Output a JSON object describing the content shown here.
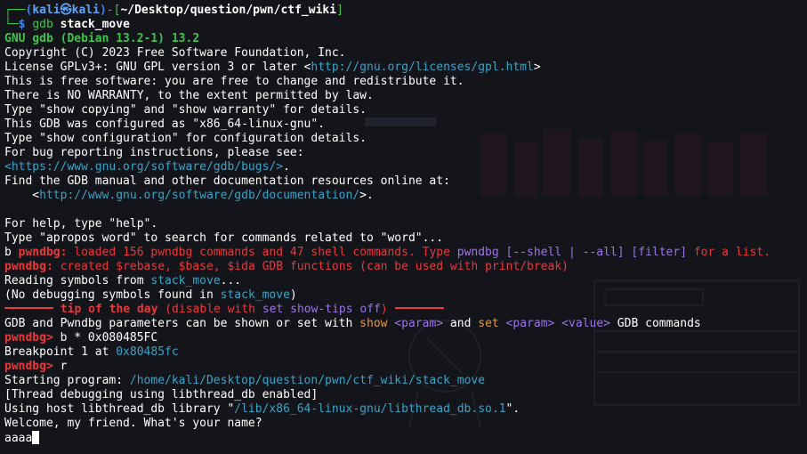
{
  "prompt": {
    "corner_top": "┌──",
    "user_host_open": "(",
    "user": "kali",
    "at_symbol": "㉿",
    "host": "kali",
    "user_host_close": ")",
    "dash_bracket_open": "-[",
    "cwd": "~/Desktop/question/pwn/ctf_wiki",
    "bracket_close": "]",
    "corner_bottom": "└─",
    "dollar": "$",
    "command_name": "gdb",
    "command_arg": "stack_move"
  },
  "gdb": {
    "banner": "GNU gdb (Debian 13.2-1) 13.2",
    "copyright": "Copyright (C) 2023 Free Software Foundation, Inc.",
    "license_prefix": "License GPLv3+: GNU GPL version 3 or later <",
    "license_url": "http://gnu.org/licenses/gpl.html",
    "license_suffix": ">",
    "free_software": "This is free software: you are free to change and redistribute it.",
    "no_warranty": "There is NO WARRANTY, to the extent permitted by law.",
    "show_copying": "Type \"show copying\" and \"show warranty\" for details.",
    "configured_as": "This GDB was configured as \"x86_64-linux-gnu\".",
    "show_configuration": "Type \"show configuration\" for configuration details.",
    "bug_reporting": "For bug reporting instructions, please see:",
    "bugs_url": "<https://www.gnu.org/software/gdb/bugs/>",
    "bugs_suffix": ".",
    "find_manual": "Find the GDB manual and other documentation resources online at:",
    "doc_prefix": "    <",
    "doc_url": "http://www.gnu.org/software/gdb/documentation/",
    "doc_suffix": ">.",
    "help": "For help, type \"help\".",
    "apropos": "Type \"apropos word\" to search for commands related to \"word\"..."
  },
  "pwndbg": {
    "b_char": "b ",
    "prefix": "pwndbg:",
    "loaded_text": " loaded 156 pwndbg commands and 47 shell commands. Type ",
    "loaded_cmd": "pwndbg [--shell | --all] [filter]",
    "loaded_suffix": " for a list.",
    "created_text": " created $rebase, $base, $ida GDB functions (can be used with print/break)",
    "reading_prefix": "Reading symbols from ",
    "reading_file": "stack_move",
    "reading_suffix": "...",
    "nodebug_prefix": "(No debugging symbols found in ",
    "nodebug_file": "stack_move",
    "nodebug_suffix": ")",
    "tip_title": " tip of the day ",
    "tip_open": "(disable with ",
    "tip_cmd_set": "set",
    "tip_cmd_rest": " show-tips off",
    "tip_close": ") ",
    "params_prefix": "GDB and Pwndbg parameters can be shown or set with ",
    "params_show": "show",
    "params_param1": " <param>",
    "params_and": " and ",
    "params_set": "set",
    "params_param2": " <param>",
    "params_value": " <value>",
    "params_suffix": " GDB commands",
    "prompt_label": "pwndbg>",
    "break_cmd": " b * 0x080485FC",
    "breakpoint_prefix": "Breakpoint 1 at ",
    "breakpoint_addr": "0x80485fc",
    "run_cmd": " r",
    "starting_prefix": "Starting program: ",
    "starting_path": "/home/kali/Desktop/question/pwn/ctf_wiki/stack_move",
    "thread_debug": "[Thread debugging using libthread_db enabled]",
    "using_host_prefix": "Using host libthread_db library \"",
    "using_host_path": "/lib/x86_64-linux-gnu/libthread_db.so.1",
    "using_host_suffix": "\".",
    "welcome": "Welcome, my friend. What's your name?",
    "input": "aaaa"
  },
  "colors": {
    "background": "#13151b",
    "prompt_blue": "#3b84e8",
    "green": "#3fc24a",
    "red": "#e8383b",
    "purple": "#9c74e6",
    "orange": "#e59a3a",
    "cyan": "#38a4c8"
  }
}
